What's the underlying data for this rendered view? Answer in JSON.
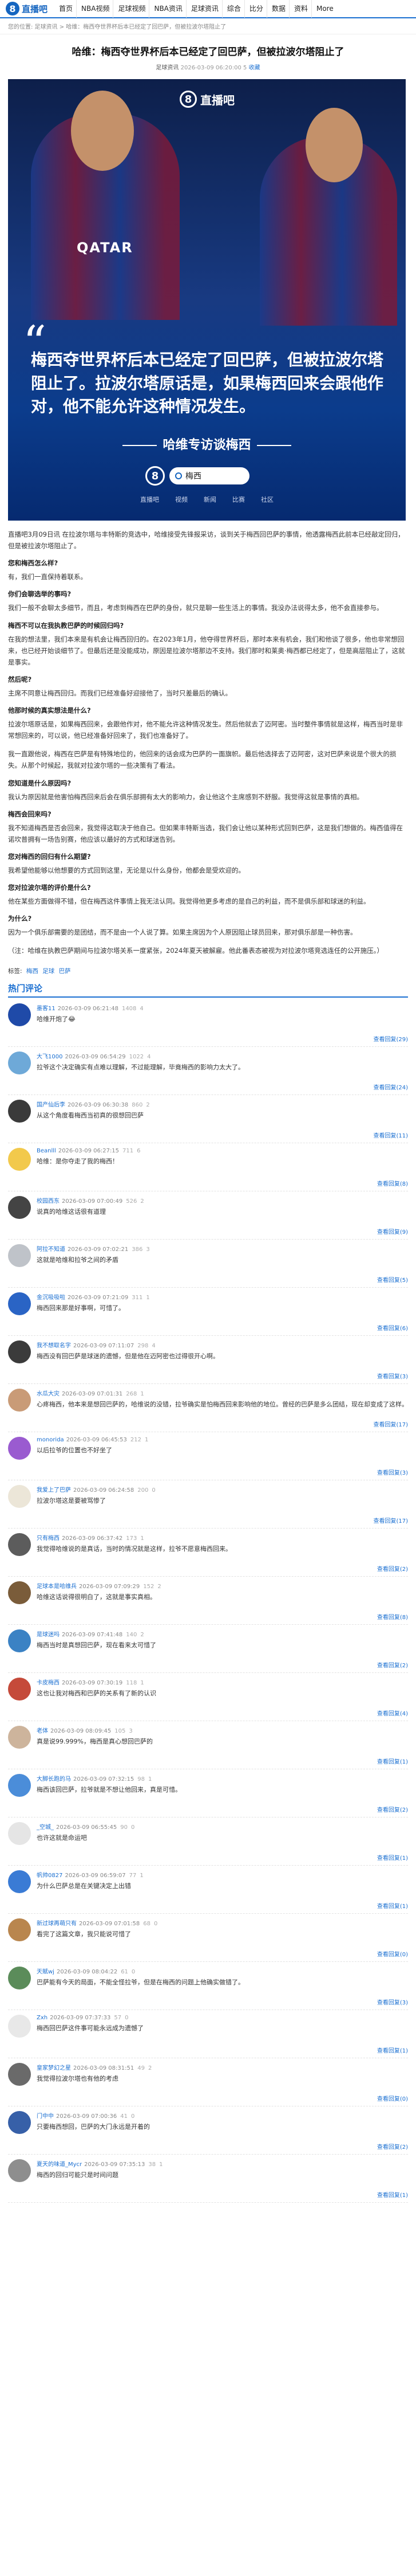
{
  "site": {
    "logo_letter": "8",
    "logo_text": "直播吧",
    "nav": [
      "首页",
      "NBA视频",
      "足球视频",
      "NBA资讯",
      "足球资讯",
      "综合",
      "比分",
      "数据",
      "资料",
      "More"
    ]
  },
  "breadcrumb": "您的位置: 足球资讯 > 哈维：梅西夺世界杯后本已经定了回巴萨，但被拉波尔塔阻止了",
  "article": {
    "title": "哈维：梅西夺世界杯后本已经定了回巴萨，但被拉波尔塔阻止了",
    "source": "足球资讯",
    "date": "2026-03-09 06:20:00",
    "comments_count": "5",
    "favorite": "收藏",
    "hero": {
      "brand": "直播吧",
      "shirt": "QATAR",
      "quote": "梅西夺世界杯后本已经定了回巴萨，但被拉波尔塔阻止了。拉波尔塔原话是，如果梅西回来会跟他作对，他不能允许这种情况发生。",
      "subtitle": "哈维专访谈梅西",
      "search": "梅西",
      "apps": [
        "直播吧",
        "视频",
        "新闻",
        "比赛",
        "社区"
      ]
    },
    "paragraphs": [
      {
        "t": "p",
        "v": "直播吧3月09日讯 在拉波尔塔与丰特斯的竞选中，哈维接受先锋报采访，谈到关于梅西回巴萨的事情，他透露梅西此前本已经敲定回归，但是被拉波尔塔阻止了。"
      },
      {
        "t": "q",
        "v": "您和梅西怎么样?"
      },
      {
        "t": "p",
        "v": "有，我们一直保持着联系。"
      },
      {
        "t": "q",
        "v": "你们会聊选举的事吗?"
      },
      {
        "t": "p",
        "v": "我们一般不会聊太多细节，而且，考虑到梅西在巴萨的身份，就只是聊一些生活上的事情。我没办法说得太多，他不会直接参与。"
      },
      {
        "t": "q",
        "v": "梅西不可以在我执教巴萨的时候回归吗?"
      },
      {
        "t": "p",
        "v": "在我的想法里，我们本来是有机会让梅西回归的。在2023年1月，他夺得世界杯后，那时本来有机会，我们和他谈了很多，他也非常想回来，也已经开始谈细节了。但最后还是没能成功，原因是拉波尔塔那边不支持。我们那时和莱奥·梅西都已经定了，但是高层阻止了，这就是事实。"
      },
      {
        "t": "q",
        "v": "然后呢?"
      },
      {
        "t": "p",
        "v": "主席不同意让梅西回归。而我们已经准备好迎接他了，当时只差最后的确认。"
      },
      {
        "t": "q",
        "v": "他那时候的真实想法是什么?"
      },
      {
        "t": "p",
        "v": "拉波尔塔原话是，如果梅西回来，会跟他作对，他不能允许这种情况发生。然后他就去了迈阿密。当时整件事情就是这样，梅西当时是非常想回来的，可以说，他已经准备好回来了，我们也准备好了。"
      },
      {
        "t": "p",
        "v": "我一直跟他说，梅西在巴萨是有特殊地位的，他回来的话会成为巴萨的一面旗帜。最后他选择去了迈阿密，这对巴萨来说是个很大的损失。从那个时候起，我就对拉波尔塔的一些决策有了看法。"
      },
      {
        "t": "q",
        "v": "您知道是什么原因吗?"
      },
      {
        "t": "p",
        "v": "我认为原因就是他害怕梅西回来后会在俱乐部拥有太大的影响力，会让他这个主席感到不舒服。我觉得这就是事情的真相。"
      },
      {
        "t": "q",
        "v": "梅西会回来吗?"
      },
      {
        "t": "p",
        "v": "我不知道梅西是否会回来，我觉得这取决于他自己。但如果丰特斯当选，我们会让他以某种形式回到巴萨，这是我们想做的。梅西值得在诺坎普拥有一场告别赛，他应该以最好的方式和球迷告别。"
      },
      {
        "t": "q",
        "v": "您对梅西的回归有什么期望?"
      },
      {
        "t": "p",
        "v": "我希望他能够以他想要的方式回到这里，无论是以什么身份，他都会是受欢迎的。"
      },
      {
        "t": "q",
        "v": "您对拉波尔塔的评价是什么?"
      },
      {
        "t": "p",
        "v": "他在某些方面做得不错，但在梅西这件事情上我无法认同。我觉得他更多考虑的是自己的利益，而不是俱乐部和球迷的利益。"
      },
      {
        "t": "q",
        "v": "为什么?"
      },
      {
        "t": "p",
        "v": "因为一个俱乐部需要的是团结，而不是由一个人说了算。如果主席因为个人原因阻止球员回来，那对俱乐部是一种伤害。"
      },
      {
        "t": "p",
        "v": "（注：哈维在执教巴萨期间与拉波尔塔关系一度紧张，2024年夏天被解雇。他此番表态被视为对拉波尔塔竞选连任的公开施压。）"
      }
    ],
    "tags_label": "标签:",
    "tags": [
      "梅西",
      "足球",
      "巴萨"
    ]
  },
  "comments_title": "热门评论",
  "comments": [
    {
      "user": "墨客11",
      "time": "2026-03-09 06:21:48",
      "text": "哈维开炮了😂",
      "up": "1408",
      "down": "4",
      "reply": "查看回复(29)"
    },
    {
      "user": "大飞1000",
      "time": "2026-03-09 06:54:29",
      "text": "拉爷这个决定确实有点难以理解，不过能理解，毕竟梅西的影响力太大了。",
      "up": "1022",
      "down": "4",
      "reply": "查看回复(24)"
    },
    {
      "user": "国产仙后李",
      "time": "2026-03-09 06:30:38",
      "text": "从这个角度看梅西当初真的很想回巴萨",
      "up": "860",
      "down": "2",
      "reply": "查看回复(11)"
    },
    {
      "user": "Beanlll",
      "time": "2026-03-09 06:27:15",
      "text": "哈维：是你夺走了我的梅西！",
      "up": "711",
      "down": "6",
      "reply": "查看回复(8)"
    },
    {
      "user": "校园西东",
      "time": "2026-03-09 07:00:49",
      "text": "说真的哈维这话很有道理",
      "up": "526",
      "down": "2",
      "reply": "查看回复(9)"
    },
    {
      "user": "阿拉不知道",
      "time": "2026-03-09 07:02:21",
      "text": "这就是哈维和拉爷之间的矛盾",
      "up": "386",
      "down": "3",
      "reply": "查看回复(5)"
    },
    {
      "user": "金沉吸吸啦",
      "time": "2026-03-09 07:21:09",
      "text": "梅西回来那是好事啊，可惜了。",
      "up": "311",
      "down": "1",
      "reply": "查看回复(6)"
    },
    {
      "user": "我不想取名字",
      "time": "2026-03-09 07:11:07",
      "text": "梅西没有回巴萨是球迷的遗憾，但是他在迈阿密也过得很开心啊。",
      "up": "298",
      "down": "4",
      "reply": "查看回复(3)"
    },
    {
      "user": "水瓜大灾",
      "time": "2026-03-09 07:01:31",
      "text": "心疼梅西，他本来是想回巴萨的，哈维说的没错，拉爷确实是怕梅西回来影响他的地位。曾经的巴萨是多么团结，现在却变成了这样。",
      "up": "268",
      "down": "1",
      "reply": "查看回复(17)"
    },
    {
      "user": "monorida",
      "time": "2026-03-09 06:45:53",
      "text": "以后拉爷的位置也不好坐了",
      "up": "212",
      "down": "1",
      "reply": "查看回复(3)"
    },
    {
      "user": "我爱上了巴萨",
      "time": "2026-03-09 06:24:58",
      "text": "拉波尔塔这是要被骂惨了",
      "up": "200",
      "down": "0",
      "reply": "查看回复(17)"
    },
    {
      "user": "只有梅西",
      "time": "2026-03-09 06:37:42",
      "text": "我觉得哈维说的是真话，当时的情况就是这样，拉爷不愿意梅西回来。",
      "up": "173",
      "down": "1",
      "reply": "查看回复(2)"
    },
    {
      "user": "足球本是哈维兵",
      "time": "2026-03-09 07:09:29",
      "text": "哈维这话说得很明白了，这就是事实真相。",
      "up": "152",
      "down": "2",
      "reply": "查看回复(8)"
    },
    {
      "user": "是球迷吗",
      "time": "2026-03-09 07:41:48",
      "text": "梅西当时是真想回巴萨，现在看来太可惜了",
      "up": "140",
      "down": "2",
      "reply": "查看回复(2)"
    },
    {
      "user": "卡皮梅西",
      "time": "2026-03-09 07:30:19",
      "text": "这也让我对梅西和巴萨的关系有了新的认识",
      "up": "118",
      "down": "1",
      "reply": "查看回复(4)"
    },
    {
      "user": "老体",
      "time": "2026-03-09 08:09:45",
      "text": "真是说99.999%，梅西是真心想回巴萨的",
      "up": "105",
      "down": "3",
      "reply": "查看回复(1)"
    },
    {
      "user": "大脚长跑的马",
      "time": "2026-03-09 07:32:15",
      "text": "梅西该回巴萨，拉爷就是不想让他回来，真是可惜。",
      "up": "98",
      "down": "1",
      "reply": "查看回复(2)"
    },
    {
      "user": "_空城_",
      "time": "2026-03-09 06:55:45",
      "text": "也许这就是命运吧",
      "up": "90",
      "down": "0",
      "reply": "查看回复(1)"
    },
    {
      "user": "帆帅0827",
      "time": "2026-03-09 06:59:07",
      "text": "为什么巴萨总是在关键决定上出错",
      "up": "77",
      "down": "1",
      "reply": "查看回复(1)"
    },
    {
      "user": "新过球再萌只有",
      "time": "2026-03-09 07:01:58",
      "text": "看完了这篇文章，我只能说可惜了",
      "up": "68",
      "down": "0",
      "reply": "查看回复(0)"
    },
    {
      "user": "天赋wj",
      "time": "2026-03-09 08:04:22",
      "text": "巴萨能有今天的局面，不能全怪拉爷，但是在梅西的问题上他确实做错了。",
      "up": "61",
      "down": "0",
      "reply": "查看回复(3)"
    },
    {
      "user": "Zxh",
      "time": "2026-03-09 07:37:33",
      "text": "梅西回巴萨这件事可能永远成为遗憾了",
      "up": "57",
      "down": "0",
      "reply": "查看回复(1)"
    },
    {
      "user": "皇家梦幻之星",
      "time": "2026-03-09 08:31:51",
      "text": "我觉得拉波尔塔也有他的考虑",
      "up": "49",
      "down": "2",
      "reply": "查看回复(0)"
    },
    {
      "user": "门中中",
      "time": "2026-03-09 07:00:36",
      "text": "只要梅西想回，巴萨的大门永远是开着的",
      "up": "41",
      "down": "0",
      "reply": "查看回复(2)"
    },
    {
      "user": "夏天的味道_Mycr",
      "time": "2026-03-09 07:35:13",
      "text": "梅西的回归可能只是时间问题",
      "up": "38",
      "down": "1",
      "reply": "查看回复(1)"
    }
  ]
}
